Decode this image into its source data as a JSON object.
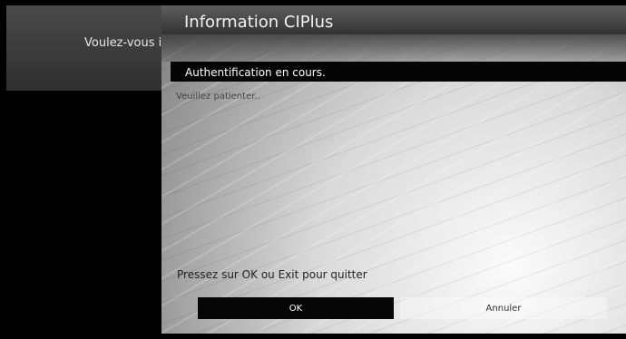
{
  "background": {
    "prompt_text": "Voulez-vous i"
  },
  "dialog": {
    "title": "Information CIPlus",
    "status": "Authentification en cours.",
    "message": "Veuillez patienter..",
    "hint": "Pressez sur OK ou Exit pour quitter",
    "buttons": {
      "ok_label": "OK",
      "cancel_label": "Annuler"
    }
  },
  "colors": {
    "title_bar": "#4a4a4a",
    "status_bar": "#050505",
    "selected_button": "#060606"
  }
}
